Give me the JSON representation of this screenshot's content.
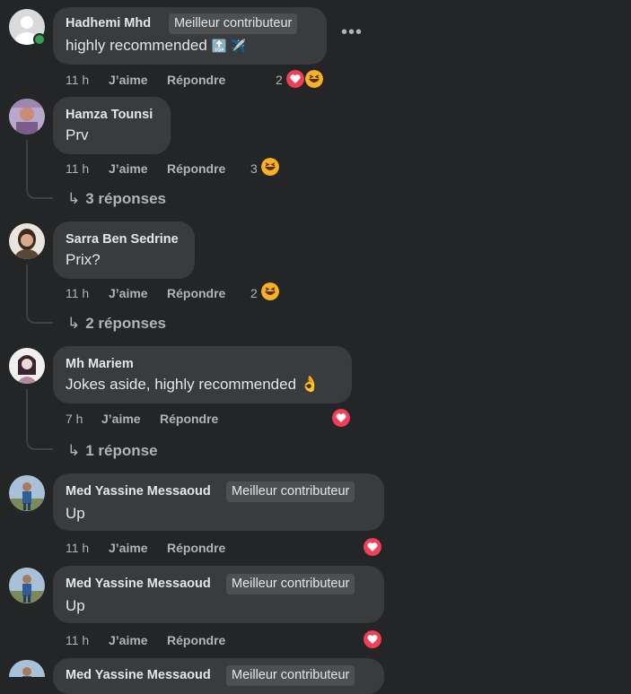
{
  "labels": {
    "like": "J’aime",
    "reply": "Répondre"
  },
  "badge_text": "Meilleur contributeur",
  "more_icon": "more-horizontal-icon",
  "colors": {
    "background": "#242526",
    "bubble": "#3a3b3c",
    "meta": "#b0b3b8",
    "love": "#f33e58",
    "haha": "#f7b125",
    "online": "#31a24c"
  },
  "comments": [
    {
      "author": "Hadhemi Mhd",
      "badge": "Meilleur contributeur",
      "text": "highly recommended",
      "emoji": "🔝 ✈️",
      "time": "11 h",
      "reaction_count": "2",
      "reactions": [
        "love",
        "haha"
      ]
    },
    {
      "author": "Hamza Tounsi",
      "text": "Prv",
      "time": "11 h",
      "reaction_count": "3",
      "reactions": [
        "haha"
      ],
      "replies": "3 réponses"
    },
    {
      "author": "Sarra Ben Sedrine",
      "text": "Prix?",
      "time": "11 h",
      "reaction_count": "2",
      "reactions": [
        "haha"
      ],
      "replies": "2 réponses"
    },
    {
      "author": "Mh Mariem",
      "text": "Jokes aside, highly recommended",
      "emoji": "👌",
      "time": "7 h",
      "reactions": [
        "love"
      ],
      "replies": "1 réponse"
    },
    {
      "author": "Med Yassine Messaoud",
      "badge": "Meilleur contributeur",
      "text": "Up",
      "time": "11 h",
      "reactions": [
        "love"
      ]
    },
    {
      "author": "Med Yassine Messaoud",
      "badge": "Meilleur contributeur",
      "text": "Up",
      "time": "11 h",
      "reactions": [
        "love"
      ]
    },
    {
      "author": "Med Yassine Messaoud",
      "badge": "Meilleur contributeur"
    }
  ]
}
